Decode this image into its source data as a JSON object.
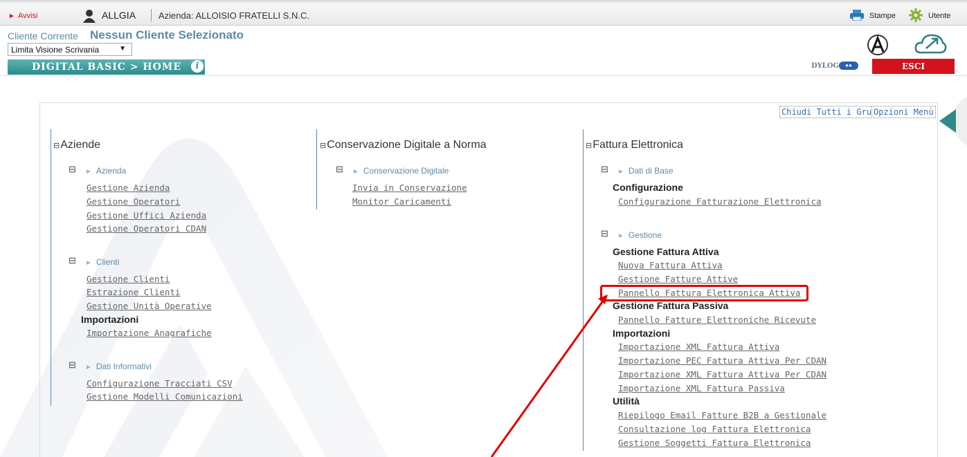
{
  "topbar": {
    "avvisi": "Avvisi",
    "user": "ALLGIA",
    "azienda": "Azienda: ALLOISIO FRATELLI S.N.C.",
    "stampe": "Stampe",
    "utente": "Utente"
  },
  "header": {
    "cliente_label": "Cliente Corrente",
    "cliente_value": "Nessun Cliente Selezionato",
    "select_value": "Limita Visione Scrivania",
    "breadcrumb": "DIGITAL BASIC > HOME",
    "dylog": "DYLOG",
    "esci": "ESCI"
  },
  "panel": {
    "chiudi": "Chiudi Tutti i Gruppi",
    "opzioni": "Opzioni Menù"
  },
  "col1": {
    "title": "Aziende",
    "azienda": {
      "label": "Azienda",
      "links": [
        "Gestione Azienda",
        "Gestione Operatori",
        "Gestione Uffici Azienda",
        "Gestione Operatori CDAN"
      ]
    },
    "clienti": {
      "label": "Clienti",
      "links": [
        "Gestione Clienti",
        "Estrazione Clienti",
        "Gestione Unità Operative"
      ],
      "importazioni": "Importazioni",
      "importazioni_link": "Importazione Anagrafiche"
    },
    "dati": {
      "label": "Dati Informativi",
      "links": [
        "Configurazione Tracciati CSV",
        "Gestione Modelli Comunicazioni"
      ]
    }
  },
  "col2": {
    "title": "Conservazione Digitale a Norma",
    "sub": {
      "label": "Conservazione Digitale",
      "links": [
        "Invia in Conservazione",
        "Monitor Caricamenti"
      ]
    }
  },
  "col3": {
    "title": "Fattura Elettronica",
    "base": {
      "label": "Dati di Base",
      "heading": "Configurazione",
      "link": "Configurazione Fatturazione Elettronica"
    },
    "gestione": {
      "label": "Gestione",
      "h_attiva": "Gestione Fattura Attiva",
      "attiva_links": [
        "Nuova Fattura Attiva",
        "Gestione Fatture Attive",
        "Pannello Fattura Elettronica Attiva"
      ],
      "h_passiva": "Gestione Fattura Passiva",
      "passiva_link": "Pannello Fatture Elettroniche Ricevute",
      "h_importazioni": "Importazioni",
      "import_links": [
        "Importazione XML Fattura Attiva",
        "Importazione PEC Fattura Attiva Per CDAN",
        "Importazione XML Fattura Attiva Per CDAN",
        "Importazione XML Fattura Passiva"
      ],
      "h_utilita": "Utilità",
      "utilita_links": [
        "Riepilogo Email Fatture B2B a Gestionale",
        "Consultazione log Fattura Elettronica",
        "Gestione Soggetti Fattura Elettronica"
      ]
    }
  },
  "colors": {
    "accent_teal": "#2b8c8b",
    "link_blue": "#5b8aa8",
    "exit_red": "#d4121c",
    "annotation_red": "#e00000"
  }
}
